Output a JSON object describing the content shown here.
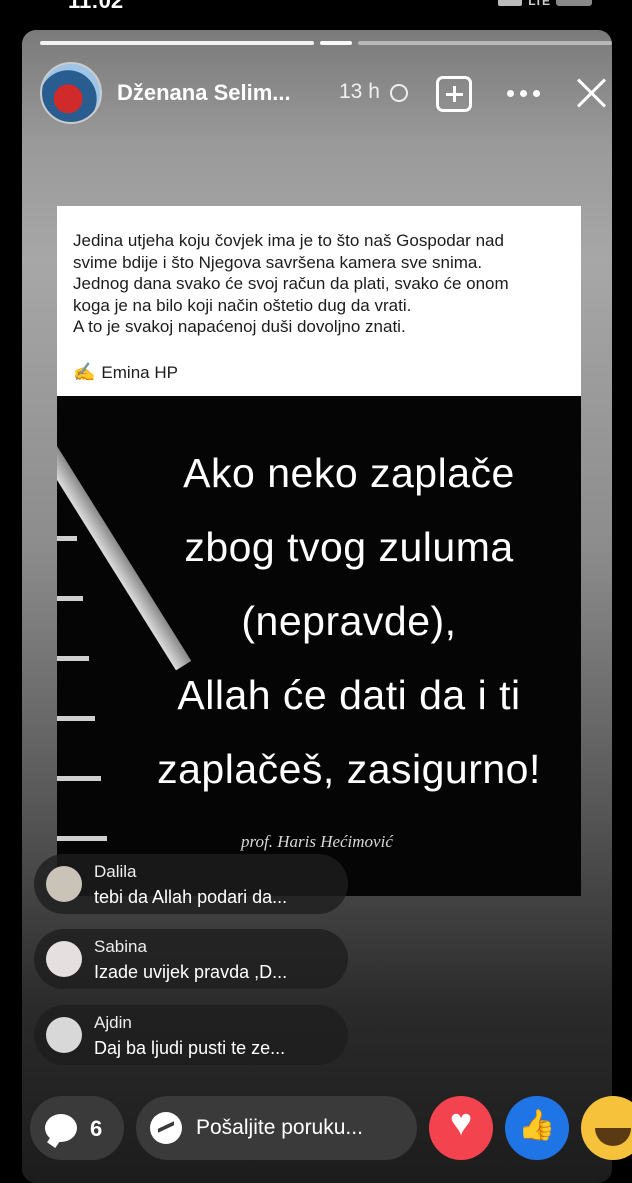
{
  "status": {
    "time": "11:02",
    "network": "LTE"
  },
  "story": {
    "author": "Dženana Selim...",
    "time": "13 h"
  },
  "post": {
    "lines": [
      "Jedina utjeha koju čovjek ima je to što naš Gospodar nad",
      "svime bdije i što Njegova savršena kamera sve snima.",
      "Jednog dana svako će svoj račun da plati, svako će onom",
      "koga je na bilo koji način oštetio dug da vrati.",
      "A to je svakoj napaćenoj duši dovoljno znati."
    ],
    "signature_emoji": "✍️",
    "signature": "Emina HP"
  },
  "quote": {
    "lines": [
      "Ako neko zaplače",
      "zbog tvog zuluma",
      "(nepravde),",
      "Allah će dati da i ti",
      "zaplačeš, zasigurno!"
    ],
    "author": "prof. Haris Hećimović"
  },
  "comments": [
    {
      "name": "Dalila",
      "text": "tebi da Allah podari da..."
    },
    {
      "name": "Sabina",
      "text": "Izade uvijek pravda ,D..."
    },
    {
      "name": "Ajdin",
      "text": "Daj ba ljudi pusti te ze..."
    }
  ],
  "bottom": {
    "comment_count": "6",
    "message_placeholder": "Pošaljite poruku..."
  },
  "icons": {
    "comment": "comment-bubble-icon",
    "messenger": "messenger-icon",
    "heart": "love-reaction",
    "like": "like-reaction",
    "haha": "haha-reaction"
  },
  "colors": {
    "heart": "#f2434f",
    "like": "#1f75e6",
    "haha": "#f6c23b"
  }
}
